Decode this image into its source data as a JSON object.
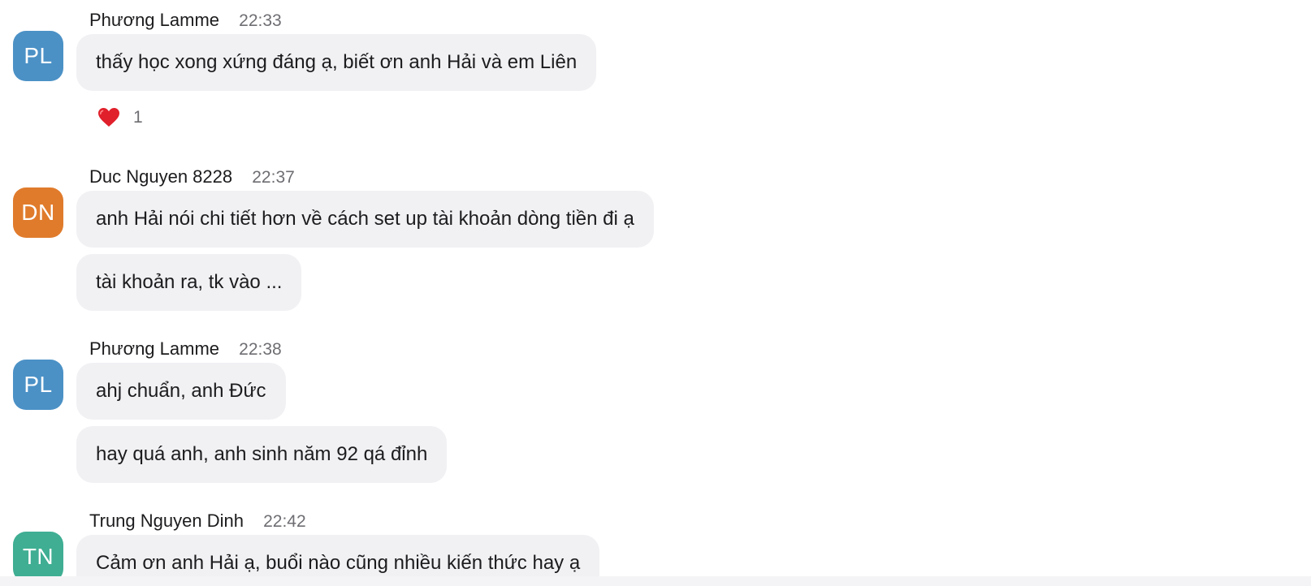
{
  "colors": {
    "bubble_bg": "#f1f1f4",
    "avatar_pl": "#4b91c6",
    "avatar_dn": "#e07b2c",
    "avatar_tn": "#3fae93",
    "time_text": "#6e6e73"
  },
  "groups": [
    {
      "sender": "Phương Lamme",
      "time": "22:33",
      "initials": "PL",
      "messages": [
        "thấy học xong xứng đáng ạ, biết ơn anh Hải và em Liên"
      ],
      "reaction": {
        "icon": "heart-icon",
        "count": "1"
      }
    },
    {
      "sender": "Duc Nguyen 8228",
      "time": "22:37",
      "initials": "DN",
      "messages": [
        "anh Hải nói chi tiết hơn về cách set up tài khoản dòng tiền đi ạ",
        "tài khoản ra, tk vào ..."
      ]
    },
    {
      "sender": "Phương Lamme",
      "time": "22:38",
      "initials": "PL",
      "messages": [
        "ahj chuẩn, anh Đức",
        "hay quá anh, anh sinh năm 92 qá đỉnh"
      ]
    },
    {
      "sender": "Trung Nguyen Dinh",
      "time": "22:42",
      "initials": "TN",
      "messages": [
        "Cảm ơn anh Hải ạ, buổi nào cũng nhiều kiến thức hay ạ"
      ]
    }
  ]
}
